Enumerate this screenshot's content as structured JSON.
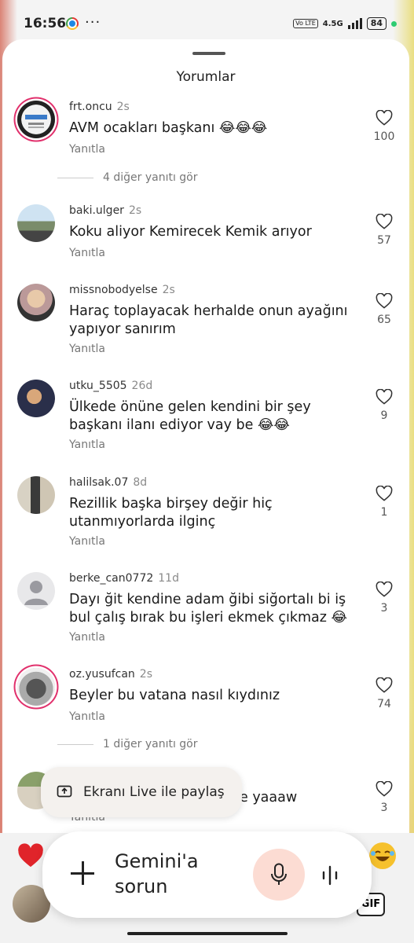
{
  "status": {
    "time": "16:56",
    "network": "4.5G",
    "volte": "Vo LTE",
    "battery": "84"
  },
  "sheet": {
    "title": "Yorumlar"
  },
  "comments": [
    {
      "user": "frt.oncu",
      "age": "2s",
      "text": "AVM ocakları başkanı 😂😂😂",
      "reply": "Yanıtla",
      "likes": "100"
    },
    {
      "user": "baki.ulger",
      "age": "2s",
      "text": "Koku aliyor Kemirecek Kemik arıyor",
      "reply": "Yanıtla",
      "likes": "57"
    },
    {
      "user": "missnobodyelse",
      "age": "2s",
      "text": "Haraç toplayacak herhalde onun ayağını yapıyor sanırım",
      "reply": "Yanıtla",
      "likes": "65"
    },
    {
      "user": "utku_5505",
      "age": "26d",
      "text": "Ülkede önüne gelen kendini bir şey başkanı ilanı ediyor vay be 😂😂",
      "reply": "Yanıtla",
      "likes": "9"
    },
    {
      "user": "halilsak.07",
      "age": "8d",
      "text": "Rezillik başka birşey değir hiç utanmıyorlarda ilginç",
      "reply": "Yanıtla",
      "likes": "1"
    },
    {
      "user": "berke_can0772",
      "age": "11d",
      "text": "Dayı ği̇t kendi̇ne adam ği̇bi̇ si̇ğortalı bi̇ i̇ş bul çalış bırak bu i̇şleri̇ ekmek çıkmaz 😂",
      "reply": "Yanıtla",
      "likes": "3"
    },
    {
      "user": "oz.yusufcan",
      "age": "2s",
      "text": "Beyler bu vatana nasıl kıydınız",
      "reply": "Yanıtla",
      "likes": "74"
    },
    {
      "user": "",
      "age": "",
      "text": "e yaaaw",
      "reply": "Yanıtla",
      "likes": "3"
    }
  ],
  "more_replies": [
    "4 diğer yanıtı gör",
    "1 diğer yanıtı gör"
  ],
  "live_chip": {
    "label": "Ekranı Live ile paylaş"
  },
  "gemini": {
    "prompt": "Gemini'a sorun"
  },
  "input": {
    "gif_label": "GIF"
  }
}
